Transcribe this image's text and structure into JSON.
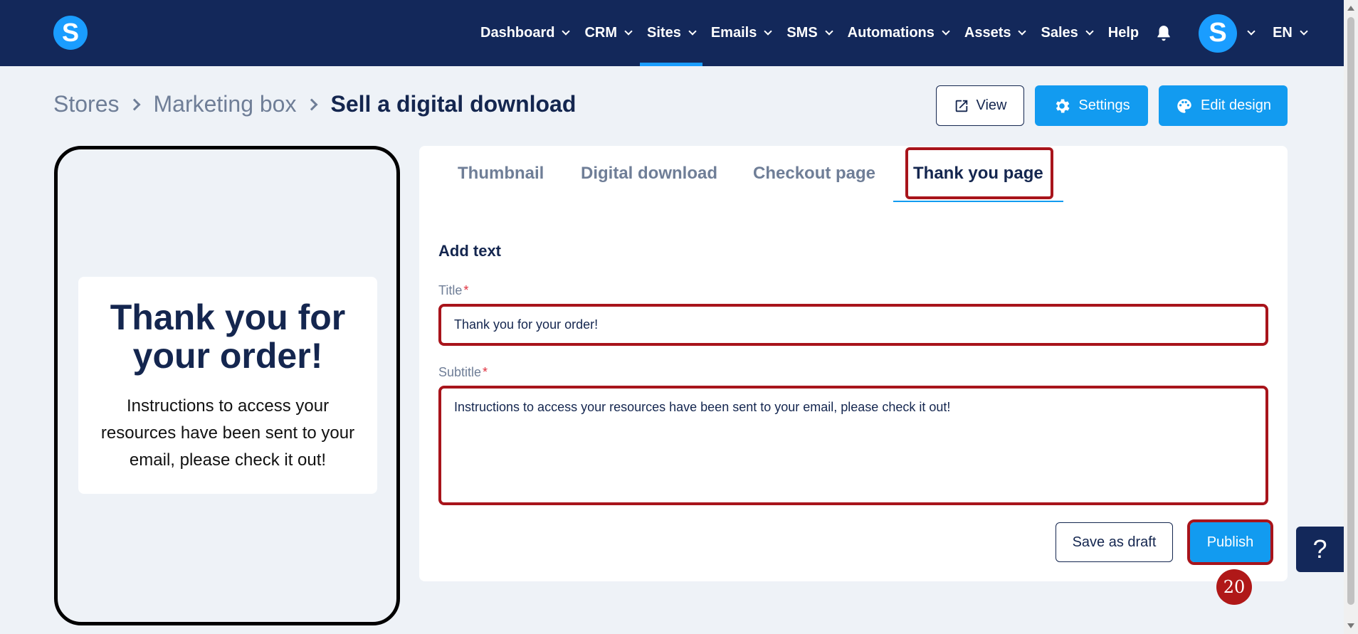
{
  "nav": {
    "logo_letter": "S",
    "items": [
      {
        "label": "Dashboard",
        "dropdown": true
      },
      {
        "label": "CRM",
        "dropdown": true
      },
      {
        "label": "Sites",
        "dropdown": true,
        "active": true
      },
      {
        "label": "Emails",
        "dropdown": true
      },
      {
        "label": "SMS",
        "dropdown": true
      },
      {
        "label": "Automations",
        "dropdown": true
      },
      {
        "label": "Assets",
        "dropdown": true
      },
      {
        "label": "Sales",
        "dropdown": true
      },
      {
        "label": "Help",
        "dropdown": false
      }
    ],
    "avatar_letter": "S",
    "language": "EN",
    "accent_color": "#1a9dff",
    "bar_color": "#13285a"
  },
  "breadcrumb": {
    "items": [
      "Stores",
      "Marketing box"
    ],
    "current": "Sell a digital download"
  },
  "header_buttons": {
    "view": "View",
    "settings": "Settings",
    "edit_design": "Edit design"
  },
  "preview": {
    "title": "Thank you for your order!",
    "subtitle": "Instructions to access your resources have been sent to your email, please check it out!"
  },
  "tabs": {
    "thumbnail": "Thumbnail",
    "digital_download": "Digital download",
    "checkout_page": "Checkout page",
    "thank_you_page": "Thank you page",
    "active": "Thank you page"
  },
  "form": {
    "section_title": "Add text",
    "title_label": "Title",
    "title_value": "Thank you for your order!",
    "subtitle_label": "Subtitle",
    "subtitle_value": "Instructions to access your resources have been sent to your email, please check it out!",
    "required_mark": "*"
  },
  "actions": {
    "save_draft": "Save as draft",
    "publish": "Publish"
  },
  "annotation": {
    "step_number": "20",
    "highlight_color": "#a8141b"
  },
  "help": {
    "label": "?"
  }
}
